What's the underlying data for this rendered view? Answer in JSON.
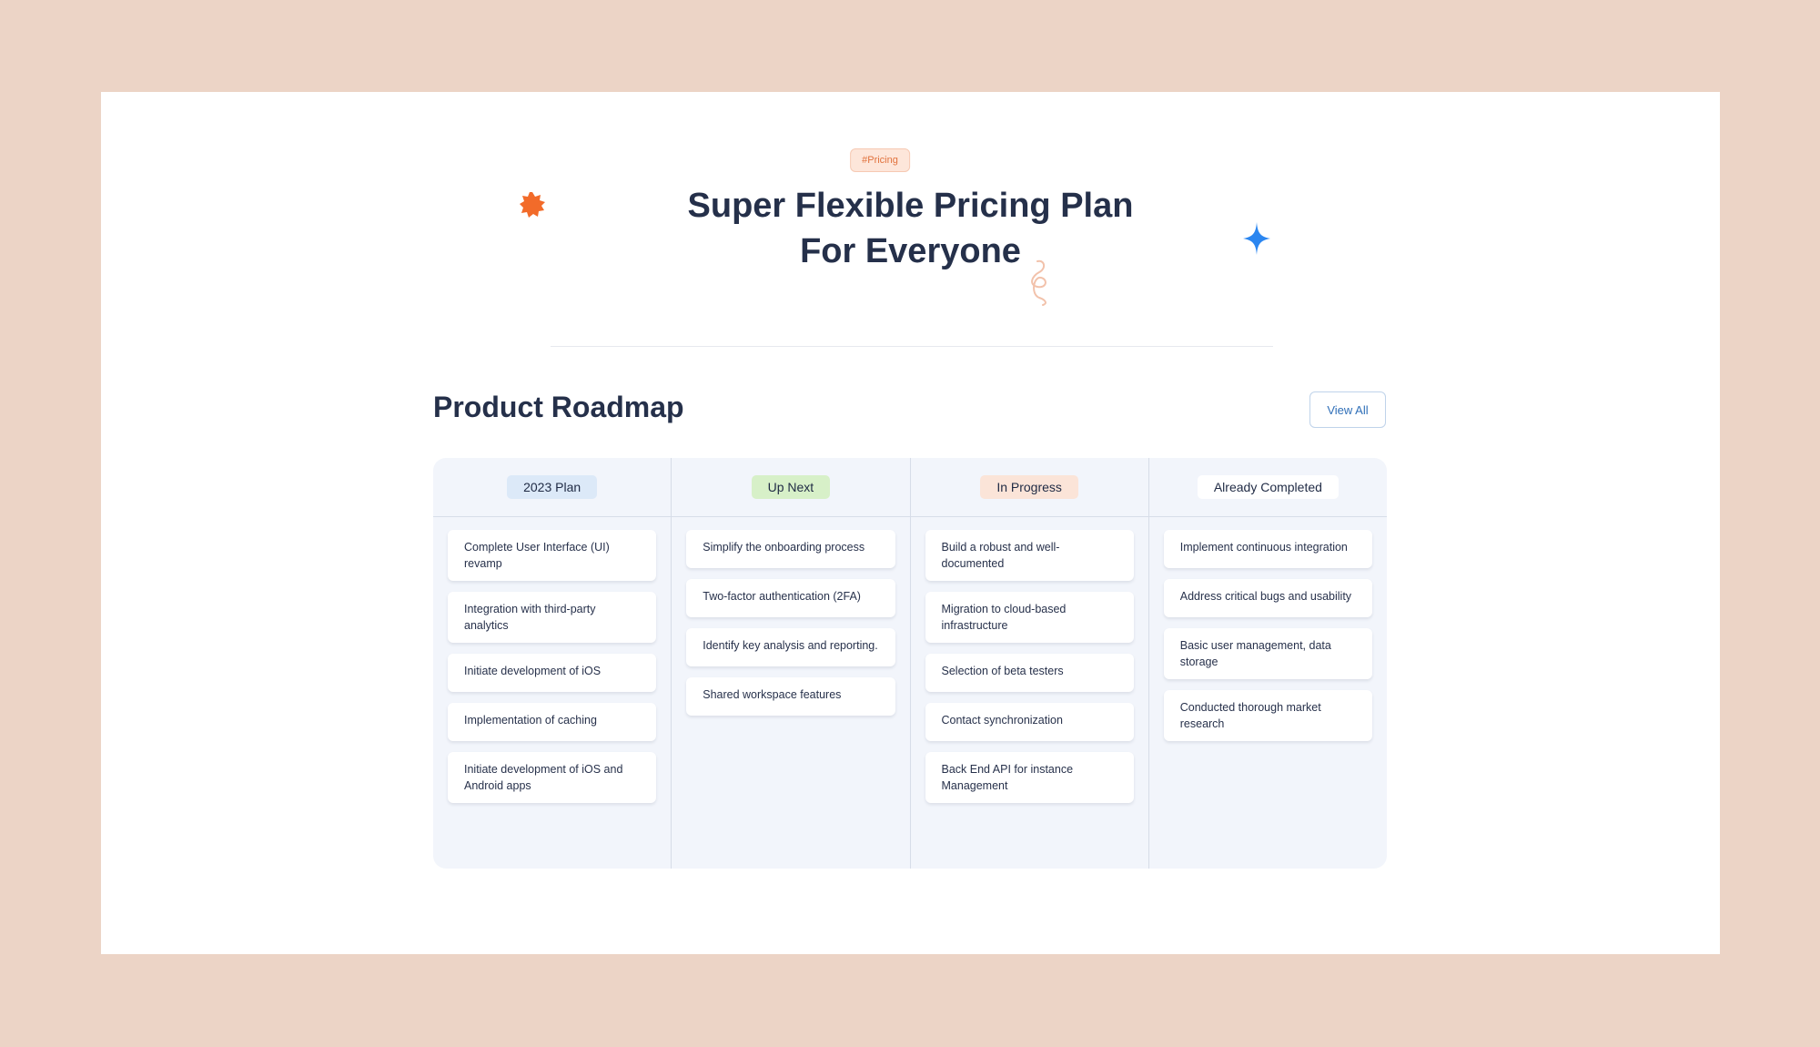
{
  "hero": {
    "tag": "#Pricing",
    "title_line1": "Super Flexible Pricing Plan",
    "title_line2": "For Everyone"
  },
  "roadmap": {
    "title": "Product Roadmap",
    "view_all": "View All",
    "columns": [
      {
        "label": "2023 Plan",
        "items": [
          "Complete User Interface (UI) revamp",
          "Integration with third-party analytics",
          "Initiate development of iOS",
          "Implementation of caching",
          "Initiate development of iOS and Android apps"
        ]
      },
      {
        "label": "Up Next",
        "items": [
          "Simplify the onboarding process",
          "Two-factor authentication (2FA)",
          "Identify key analysis and reporting.",
          "Shared workspace features"
        ]
      },
      {
        "label": "In Progress",
        "items": [
          "Build a robust and well-documented",
          "Migration to cloud-based infrastructure",
          "Selection of beta testers",
          "Contact synchronization",
          "Back End API for instance Management"
        ]
      },
      {
        "label": "Already Completed",
        "items": [
          "Implement continuous integration",
          "Address critical bugs and usability",
          "Basic user management, data storage",
          "Conducted thorough market research"
        ]
      }
    ]
  },
  "colors": {
    "page_bg": "#ecd4c6",
    "card_bg": "#ffffff",
    "accent_orange": "#f26b2a",
    "accent_blue": "#2b86f0",
    "heading": "#25304a",
    "board_bg": "#f2f5fb"
  },
  "icons": {
    "burst": "orange-burst-icon",
    "sparkle": "blue-sparkle-icon",
    "squiggle": "squiggle-icon"
  }
}
